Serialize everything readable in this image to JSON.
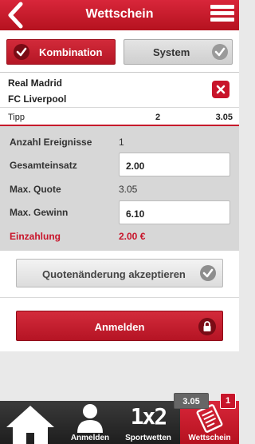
{
  "header": {
    "title": "Wettschein"
  },
  "tabs": [
    {
      "label": "Kombination",
      "active": true
    },
    {
      "label": "System",
      "active": false
    }
  ],
  "entry": {
    "team1": "Real Madrid",
    "team2": "FC Liverpool",
    "tip_label": "Tipp",
    "tip_pick": "2",
    "tip_odds": "3.05"
  },
  "summary": {
    "events_label": "Anzahl Ereignisse",
    "events_value": "1",
    "stake_label": "Gesamteinsatz",
    "stake_value": "2.00",
    "max_odds_label": "Max. Quote",
    "max_odds_value": "3.05",
    "max_win_label": "Max. Gewinn",
    "max_win_value": "6.10",
    "deposit_label": "Einzahlung",
    "deposit_value": "2.00 €"
  },
  "accept": {
    "label": "Quotenänderung akzeptieren"
  },
  "login": {
    "label": "Anmelden"
  },
  "nav": {
    "home": "",
    "login": "Anmelden",
    "sports": "Sportwetten",
    "slip": "Wettschein",
    "sports_glyph": "1x2",
    "odds_badge": "3.05",
    "count_badge": "1"
  },
  "colors": {
    "brand_red": "#c8142a",
    "nav_dark": "#2a2a2a"
  }
}
